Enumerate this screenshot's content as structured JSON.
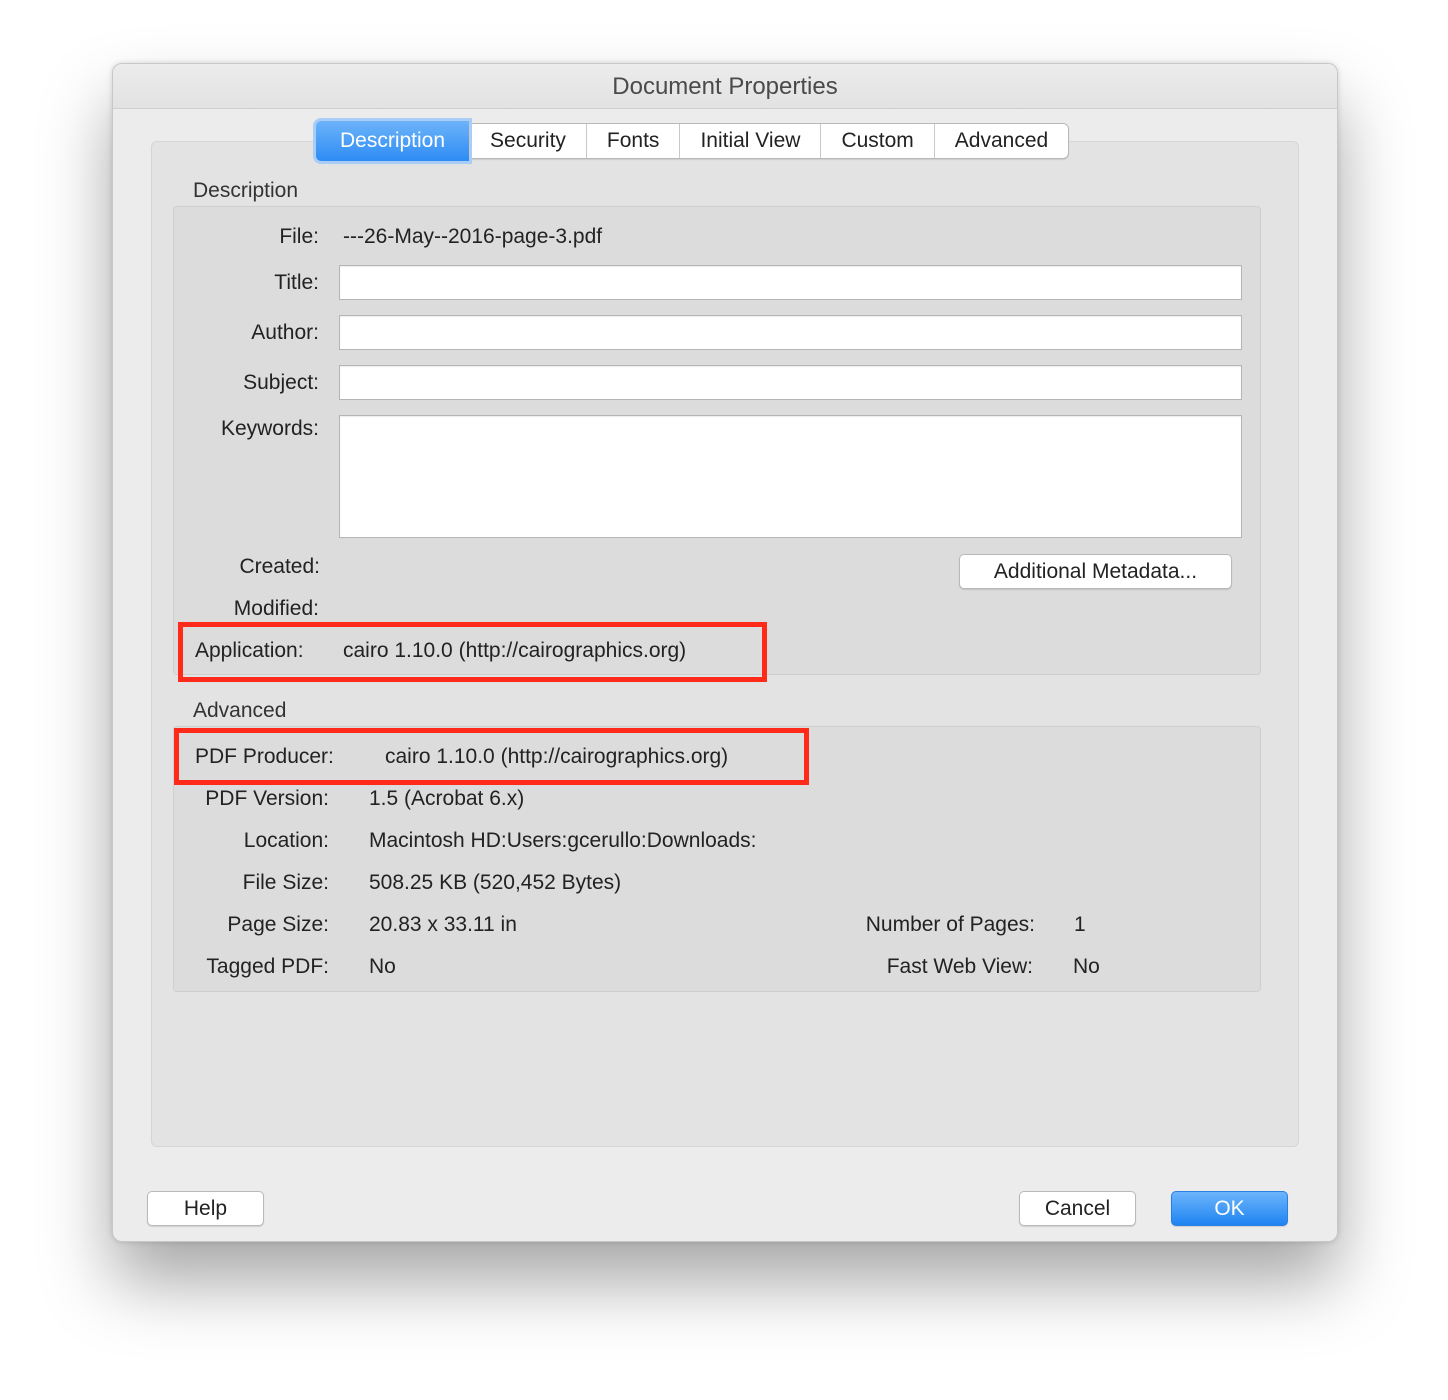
{
  "window": {
    "title": "Document Properties"
  },
  "tabs": [
    "Description",
    "Security",
    "Fonts",
    "Initial View",
    "Custom",
    "Advanced"
  ],
  "description": {
    "section_label": "Description",
    "file_label": "File:",
    "file_value": "---26-May--2016-page-3.pdf",
    "title_label": "Title:",
    "title_value": "",
    "author_label": "Author:",
    "author_value": "",
    "subject_label": "Subject:",
    "subject_value": "",
    "keywords_label": "Keywords:",
    "keywords_value": "",
    "created_label": "Created:",
    "modified_label": "Modified:",
    "application_label": "Application:",
    "application_value": "cairo 1.10.0 (http://cairographics.org)",
    "metadata_button": "Additional Metadata..."
  },
  "advanced": {
    "section_label": "Advanced",
    "producer_label": "PDF Producer:",
    "producer_value": "cairo 1.10.0 (http://cairographics.org)",
    "version_label": "PDF Version:",
    "version_value": "1.5 (Acrobat 6.x)",
    "location_label": "Location:",
    "location_value": "Macintosh HD:Users:gcerullo:Downloads:",
    "filesize_label": "File Size:",
    "filesize_value": "508.25 KB (520,452 Bytes)",
    "pagesize_label": "Page Size:",
    "pagesize_value": "20.83 x 33.11 in",
    "numpages_label": "Number of Pages:",
    "numpages_value": "1",
    "tagged_label": "Tagged PDF:",
    "tagged_value": "No",
    "fastweb_label": "Fast Web View:",
    "fastweb_value": "No"
  },
  "buttons": {
    "help": "Help",
    "cancel": "Cancel",
    "ok": "OK"
  },
  "colors": {
    "accent": "#2e8cf4",
    "highlight": "#ff2a1a"
  }
}
